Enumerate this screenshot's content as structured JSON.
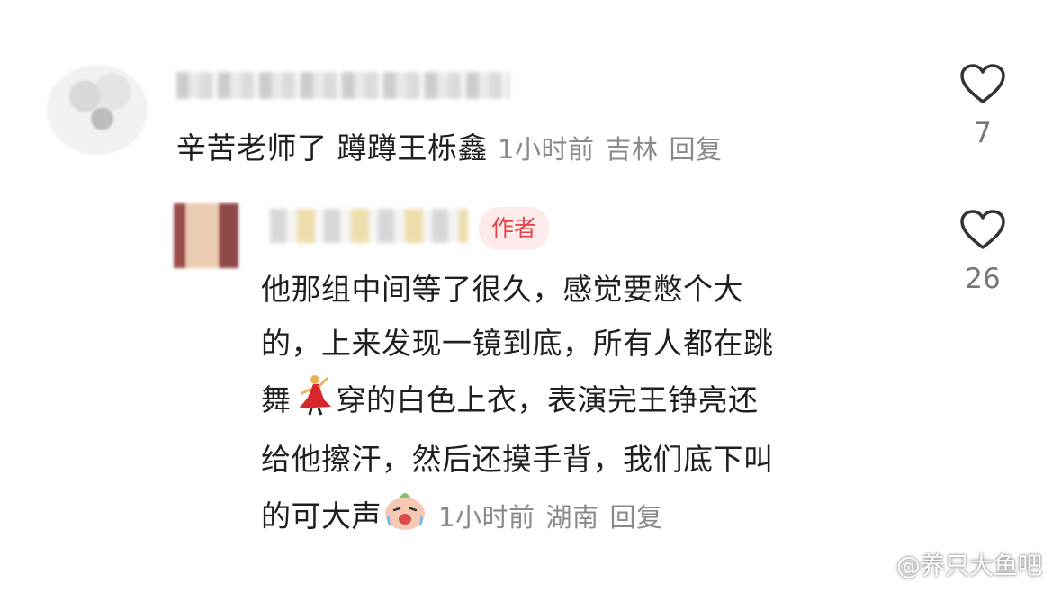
{
  "comments": [
    {
      "text": "辛苦老师了 蹲蹲王栎鑫",
      "time": "1小时前",
      "location": "吉林",
      "reply_label": "回复",
      "like_count": "7"
    }
  ],
  "reply": {
    "badge": "作者",
    "lines": [
      "他那组中间等了很久，感觉要憋个大",
      "的，上来发现一镜到底，所有人都在跳",
      "穿的白色上衣，表演完王铮亮还",
      "给他擦汗，然后还摸手背，我们底下叫",
      "的可大声"
    ],
    "line3_prefix": "舞",
    "time": "1小时前",
    "location": "湖南",
    "reply_label": "回复",
    "like_count": "26"
  },
  "watermark": "@养只大鱼吧",
  "colors": {
    "badge_text": "#e0454b",
    "badge_bg": "#fdebeb",
    "meta": "#8a8a8a"
  }
}
